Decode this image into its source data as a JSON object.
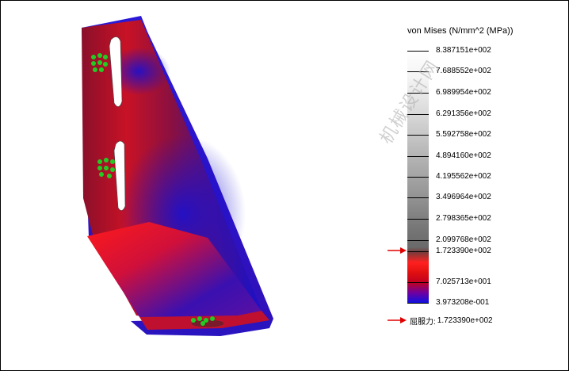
{
  "legend": {
    "title": "von Mises (N/mm^2 (MPa))",
    "ticks": [
      {
        "label": "8.387151e+002",
        "level": 1.0
      },
      {
        "label": "7.688552e+002",
        "level": 0.917
      },
      {
        "label": "6.989954e+002",
        "level": 0.833
      },
      {
        "label": "6.291356e+002",
        "level": 0.75
      },
      {
        "label": "5.592758e+002",
        "level": 0.667
      },
      {
        "label": "4.894160e+002",
        "level": 0.583
      },
      {
        "label": "4.195562e+002",
        "level": 0.5
      },
      {
        "label": "3.496964e+002",
        "level": 0.417
      },
      {
        "label": "2.798365e+002",
        "level": 0.333
      },
      {
        "label": "2.099768e+002",
        "level": 0.25
      },
      {
        "label": "1.723390e+002",
        "level": 0.205
      },
      {
        "label": "7.025713e+001",
        "level": 0.083
      },
      {
        "label": "3.973208e-001",
        "level": 0.0
      }
    ],
    "yield_label": "屈服力:",
    "yield_value": "1.723390e+002",
    "arrow_color": "#e00000"
  },
  "watermark": "机械设计网",
  "colors": {
    "high_stress": "#ff1a1a",
    "mid_stress": "#b01030",
    "low_stress": "#1a10c8",
    "load_arrows": "#22cc22"
  }
}
